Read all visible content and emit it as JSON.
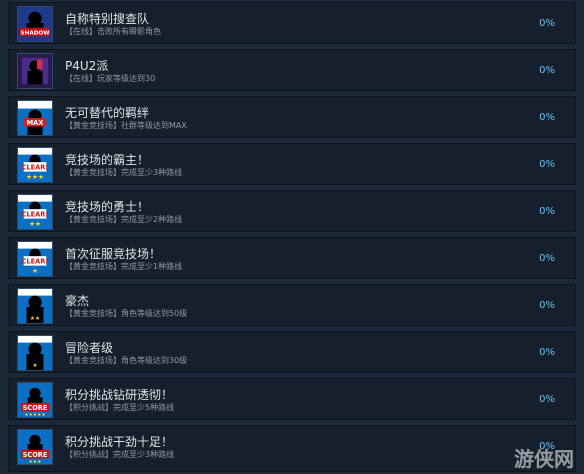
{
  "achievements": [
    {
      "title": "自称特别搜查队",
      "desc": "【在线】击败所有瞬影角色",
      "percent": "0%",
      "icon": "shadow-icon",
      "badge": "SHADOW"
    },
    {
      "title": "P4U2派",
      "desc": "【在线】玩家等级达到30",
      "percent": "0%",
      "icon": "p4u2-icon",
      "badge": ""
    },
    {
      "title": "无可替代的羁绊",
      "desc": "【黄金竞技场】社群等级达到MAX",
      "percent": "0%",
      "icon": "max-icon",
      "badge": "MAX"
    },
    {
      "title": "竞技场的霸主！",
      "desc": "【黄金竞技场】完成至少3种路线",
      "percent": "0%",
      "icon": "clear-3-icon",
      "badge": "CLEAR!"
    },
    {
      "title": "竞技场的勇士！",
      "desc": "【黄金竞技场】完成至少2种路线",
      "percent": "0%",
      "icon": "clear-2-icon",
      "badge": "CLEAR!"
    },
    {
      "title": "首次征服竞技场！",
      "desc": "【黄金竞技场】完成至少1种路线",
      "percent": "0%",
      "icon": "clear-1-icon",
      "badge": "CLEAR!"
    },
    {
      "title": "豪杰",
      "desc": "【黄金竞技场】角色等级达到50级",
      "percent": "0%",
      "icon": "golden-arena-icon",
      "badge": ""
    },
    {
      "title": "冒险者级",
      "desc": "【黄金竞技场】角色等级达到30级",
      "percent": "0%",
      "icon": "golden-arena-icon",
      "badge": ""
    },
    {
      "title": "积分挑战钻研透彻！",
      "desc": "【积分挑战】完成至少5种路线",
      "percent": "0%",
      "icon": "score-icon",
      "badge": "SCORE"
    },
    {
      "title": "积分挑战干劲十足！",
      "desc": "【积分挑战】完成至少3种路线",
      "percent": "0%",
      "icon": "score-icon",
      "badge": "SCORE"
    }
  ],
  "watermark": "游侠网",
  "colors": {
    "background": "#1b2838",
    "row": "#16202d",
    "percent": "#66c0f4",
    "title": "#dfe3e6",
    "desc": "#8f98a0"
  }
}
